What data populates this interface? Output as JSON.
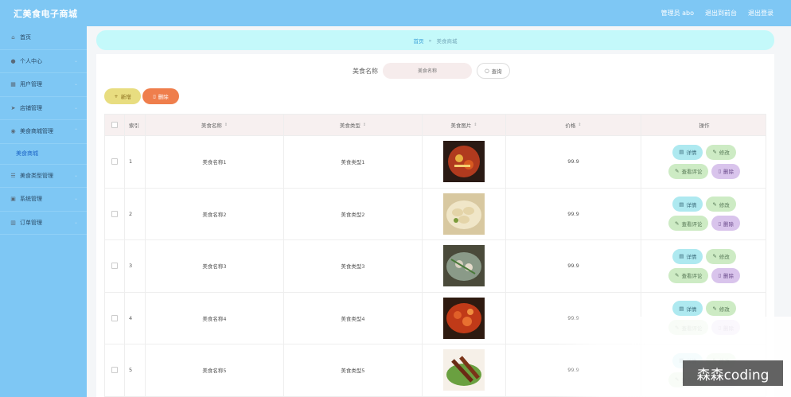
{
  "app": {
    "title": "汇美食电子商城"
  },
  "topbar": {
    "admin": "管理员 abo",
    "back_to_front": "退出到前台",
    "logout": "退出登录"
  },
  "sidebar": {
    "items": [
      {
        "label": "首页",
        "icon": "home-icon",
        "glyph": "⌂"
      },
      {
        "label": "个人中心",
        "icon": "user-icon",
        "glyph": "●"
      },
      {
        "label": "用户管理",
        "icon": "table-icon",
        "glyph": "▦"
      },
      {
        "label": "店铺管理",
        "icon": "send-icon",
        "glyph": "➤"
      },
      {
        "label": "美食商城管理",
        "icon": "location-icon",
        "glyph": "◉"
      }
    ],
    "sub_active": "美食商城",
    "items_after": [
      {
        "label": "美食类型管理",
        "icon": "list-icon",
        "glyph": "☰"
      },
      {
        "label": "系统管理",
        "icon": "settings-icon",
        "glyph": "▣"
      },
      {
        "label": "订单管理",
        "icon": "chart-icon",
        "glyph": "▥"
      }
    ]
  },
  "breadcrumb": {
    "home": "首页",
    "separator": "»",
    "current": "美食商城"
  },
  "search": {
    "label": "美食名称",
    "placeholder": "美食名称",
    "button": "查询"
  },
  "toolbar": {
    "add": "新增",
    "delete": "删除"
  },
  "table": {
    "headers": {
      "index": "索引",
      "name": "美食名称",
      "type": "美食类型",
      "image": "美食图片",
      "price": "价格",
      "ops": "操作"
    },
    "rows": [
      {
        "index": "1",
        "name": "美食名称1",
        "type": "美食类型1",
        "price": "99.9"
      },
      {
        "index": "2",
        "name": "美食名称2",
        "type": "美食类型2",
        "price": "99.9"
      },
      {
        "index": "3",
        "name": "美食名称3",
        "type": "美食类型3",
        "price": "99.9"
      },
      {
        "index": "4",
        "name": "美食名称4",
        "type": "美食类型4",
        "price": "99.9"
      },
      {
        "index": "5",
        "name": "美食名称5",
        "type": "美食类型5",
        "price": "99.9"
      }
    ],
    "ops": {
      "detail": "详情",
      "edit": "修改",
      "comment": "查看评论",
      "delete": "删除"
    }
  },
  "watermark": "森森coding"
}
